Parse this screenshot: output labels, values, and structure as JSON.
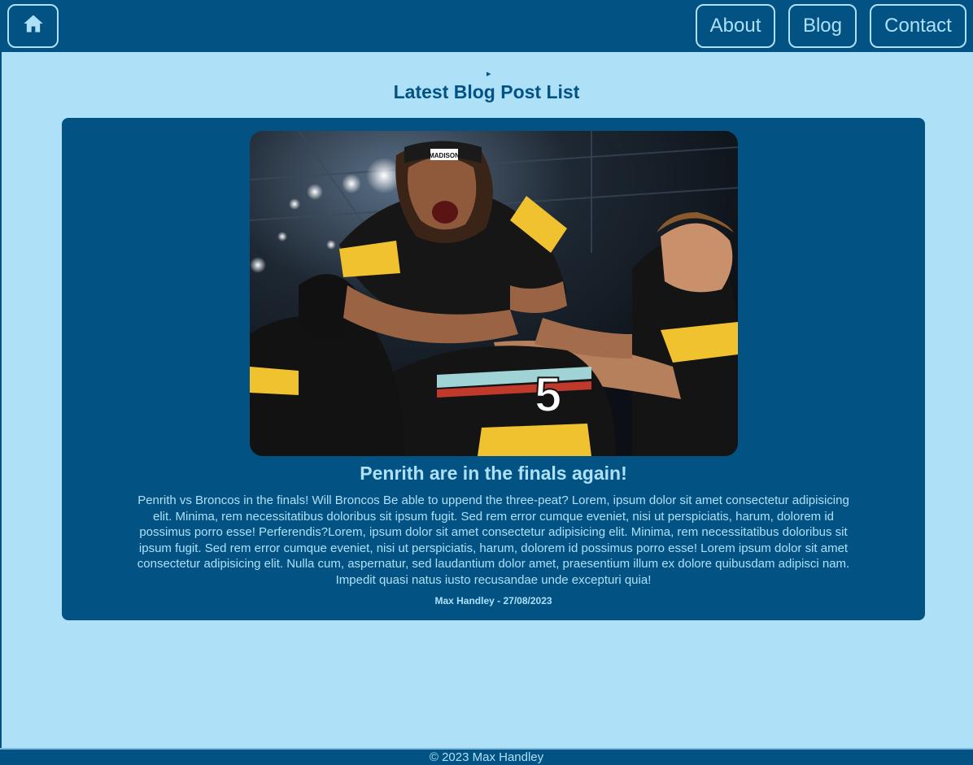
{
  "nav": {
    "home_icon": "home-icon",
    "about_label": "About",
    "blog_label": "Blog",
    "contact_label": "Contact"
  },
  "section": {
    "toggle": "▸",
    "title": "Latest Blog Post List"
  },
  "post": {
    "title": "Penrith are in the finals again!",
    "body": "Penrith vs Broncos in the finals! Will Broncos Be able to uppend the three-peat? Lorem, ipsum dolor sit amet consectetur adipisicing elit. Minima, rem necessitatibus doloribus sit ipsum fugit. Sed rem error cumque eveniet, nisi ut perspiciatis, harum, dolorem id possimus porro esse! Perferendis?Lorem, ipsum dolor sit amet consectetur adipisicing elit. Minima, rem necessitatibus doloribus sit ipsum fugit. Sed rem error cumque eveniet, nisi ut perspiciatis, harum, dolorem id possimus porro esse! Lorem ipsum dolor sit amet consectetur adipisicing elit. Nulla cum, aspernatur, sed laudantium dolor amet, praesentium illum ex dolore quibusdam adipisci nam. Impedit quasi natus iusto recusandae unde excepturi quia!",
    "meta": "Max Handley - 27/08/2023",
    "jersey_text": "MADISON"
  },
  "footer": {
    "text": "© 2023 Max Handley"
  },
  "colors": {
    "primary": "#025283",
    "background": "#aee0f8"
  }
}
